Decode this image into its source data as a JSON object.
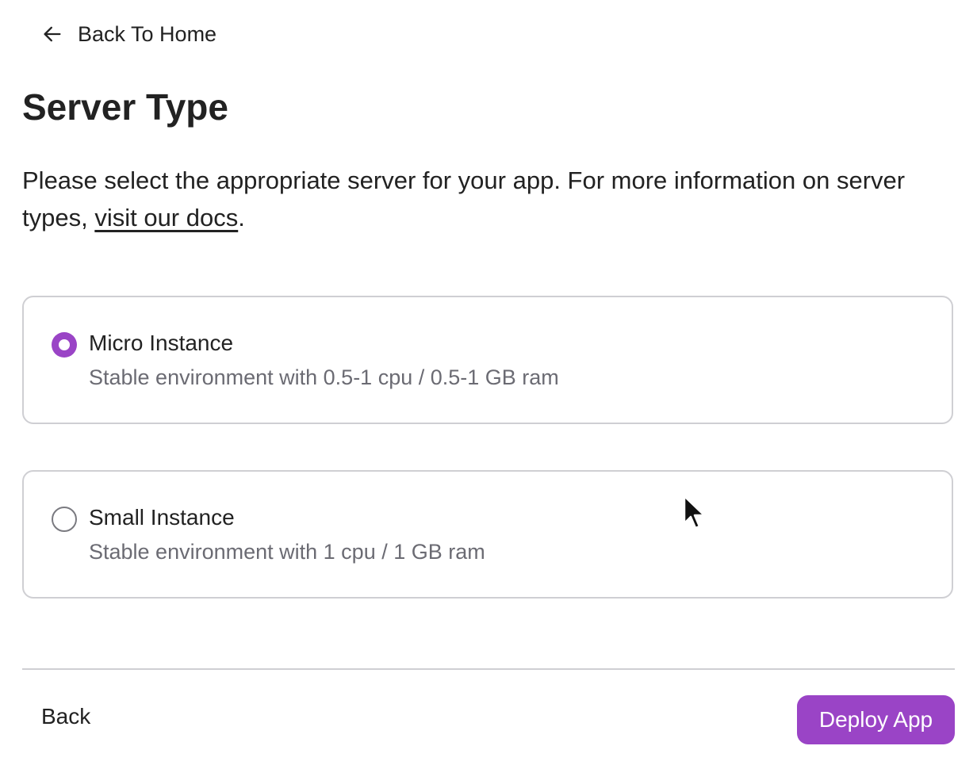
{
  "nav": {
    "back_home_label": "Back To Home",
    "back_home_icon": "arrow-left-icon"
  },
  "page": {
    "title": "Server Type",
    "description_prefix": "Please select the appropriate server for your app. For more information on server types, ",
    "docs_link": "visit our docs",
    "description_suffix": "."
  },
  "options": [
    {
      "title": "Micro Instance",
      "subtitle": "Stable environment with 0.5-1 cpu / 0.5-1 GB ram",
      "selected": true
    },
    {
      "title": "Small Instance",
      "subtitle": "Stable environment with 1 cpu / 1 GB ram",
      "selected": false
    }
  ],
  "footer": {
    "back_label": "Back",
    "deploy_label": "Deploy App"
  },
  "colors": {
    "accent": "#9a44c6",
    "border": "#cfcfd3",
    "muted_text": "#6b6b73",
    "text": "#222222"
  }
}
